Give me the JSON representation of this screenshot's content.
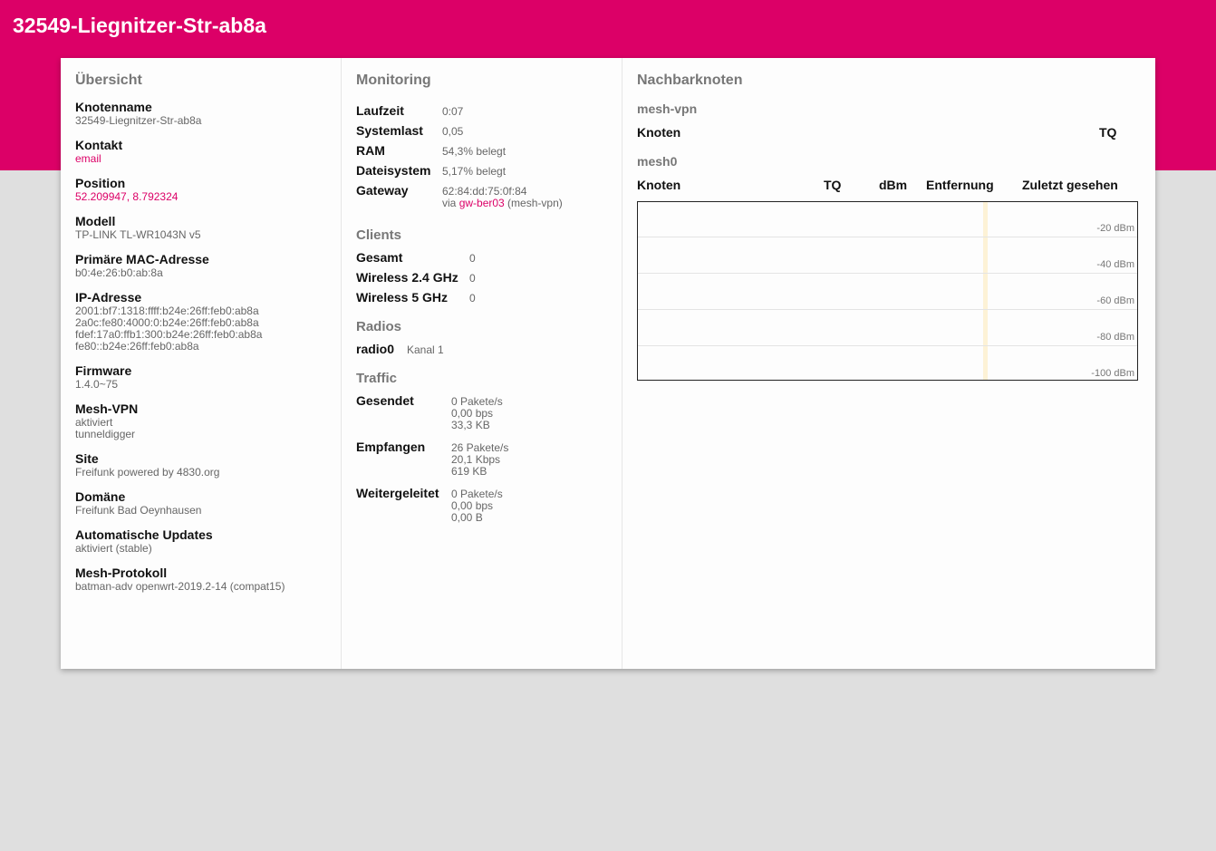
{
  "header": {
    "title": "32549-Liegnitzer-Str-ab8a"
  },
  "overview": {
    "title": "Übersicht",
    "items": [
      {
        "label": "Knotenname",
        "values": [
          "32549-Liegnitzer-Str-ab8a"
        ]
      },
      {
        "label": "Kontakt",
        "values": [
          "email"
        ],
        "link": true
      },
      {
        "label": "Position",
        "values": [
          "52.209947, 8.792324"
        ],
        "link": true
      },
      {
        "label": "Modell",
        "values": [
          "TP-LINK TL-WR1043N v5"
        ]
      },
      {
        "label": "Primäre MAC-Adresse",
        "values": [
          "b0:4e:26:b0:ab:8a"
        ]
      },
      {
        "label": "IP-Adresse",
        "values": [
          "2001:bf7:1318:ffff:b24e:26ff:feb0:ab8a",
          "2a0c:fe80:4000:0:b24e:26ff:feb0:ab8a",
          "fdef:17a0:ffb1:300:b24e:26ff:feb0:ab8a",
          "fe80::b24e:26ff:feb0:ab8a"
        ]
      },
      {
        "label": "Firmware",
        "values": [
          "1.4.0~75"
        ]
      },
      {
        "label": "Mesh-VPN",
        "values": [
          "aktiviert",
          "tunneldigger"
        ]
      },
      {
        "label": "Site",
        "values": [
          "Freifunk powered by 4830.org"
        ]
      },
      {
        "label": "Domäne",
        "values": [
          "Freifunk Bad Oeynhausen"
        ]
      },
      {
        "label": "Automatische Updates",
        "values": [
          "aktiviert (stable)"
        ]
      },
      {
        "label": "Mesh-Protokoll",
        "values": [
          "batman-adv openwrt-2019.2-14 (compat15)"
        ]
      }
    ]
  },
  "monitoring": {
    "title": "Monitoring",
    "uptime_label": "Laufzeit",
    "uptime": "0:07",
    "load_label": "Systemlast",
    "load": "0,05",
    "ram_label": "RAM",
    "ram": "54,3% belegt",
    "fs_label": "Dateisystem",
    "fs": "5,17% belegt",
    "gateway_label": "Gateway",
    "gateway_mac": "62:84:dd:75:0f:84",
    "gateway_via": "via ",
    "gateway_name": "gw-ber03",
    "gateway_iface": " (mesh-vpn)",
    "clients_title": "Clients",
    "clients": [
      {
        "label": "Gesamt",
        "value": "0"
      },
      {
        "label": "Wireless 2.4 GHz",
        "value": "0"
      },
      {
        "label": "Wireless 5 GHz",
        "value": "0"
      }
    ],
    "radios_title": "Radios",
    "radio_label": "radio0",
    "radio_value": "Kanal 1",
    "traffic_title": "Traffic",
    "traffic": [
      {
        "label": "Gesendet",
        "values": [
          "0 Pakete/s",
          "0,00 bps",
          "33,3 KB"
        ]
      },
      {
        "label": "Empfangen",
        "values": [
          "26 Pakete/s",
          "20,1 Kbps",
          "619 KB"
        ]
      },
      {
        "label": "Weitergeleitet",
        "values": [
          "0 Pakete/s",
          "0,00 bps",
          "0,00 B"
        ]
      }
    ]
  },
  "neighbours": {
    "title": "Nachbarknoten",
    "vpn_title": "mesh-vpn",
    "vpn_headers": {
      "node": "Knoten",
      "tq": "TQ"
    },
    "mesh_title": "mesh0",
    "mesh_headers": {
      "node": "Knoten",
      "tq": "TQ",
      "dbm": "dBm",
      "distance": "Entfernung",
      "last_seen": "Zuletzt gesehen"
    },
    "graph_labels": [
      "-20 dBm",
      "-40 dBm",
      "-60 dBm",
      "-80 dBm",
      "-100 dBm"
    ]
  }
}
